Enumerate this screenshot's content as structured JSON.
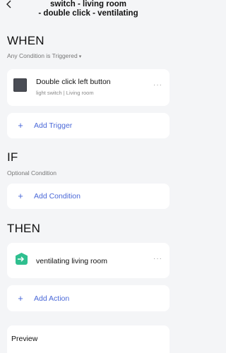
{
  "header": {
    "title_line1": "switch - living room",
    "title_line2": "- double click - ventilating"
  },
  "when": {
    "heading": "WHEN",
    "condition_mode": "Any Condition is Triggered",
    "trigger": {
      "title": "Double click left button",
      "subtitle": "light switch | Living room",
      "more": "···"
    },
    "add_label": "Add Trigger"
  },
  "if": {
    "heading": "IF",
    "subtitle": "Optional Condition",
    "add_label": "Add Condition"
  },
  "then": {
    "heading": "THEN",
    "action": {
      "title": "ventilating living room",
      "more": "···"
    },
    "add_label": "Add Action"
  },
  "preview": {
    "label": "Preview"
  },
  "colors": {
    "accent": "#4a68d8",
    "scene_icon": "#2fbf8f",
    "background": "#f4f5f7"
  }
}
